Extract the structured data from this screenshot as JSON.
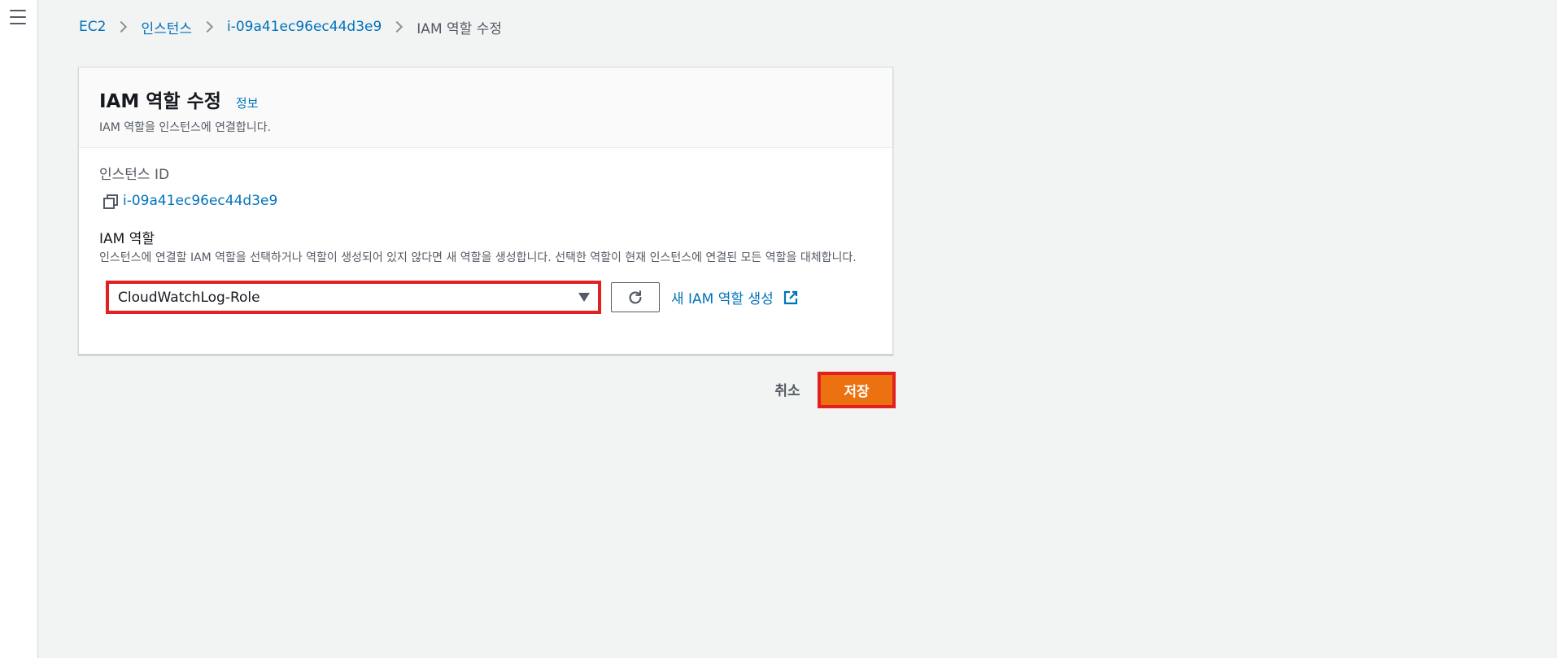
{
  "breadcrumb": {
    "items": [
      "EC2",
      "인스턴스",
      "i-09a41ec96ec44d3e9"
    ],
    "current": "IAM 역할 수정"
  },
  "panel": {
    "title": "IAM 역할 수정",
    "info": "정보",
    "description": "IAM 역할을 인스턴스에 연결합니다."
  },
  "instance": {
    "label": "인스턴스 ID",
    "id": "i-09a41ec96ec44d3e9"
  },
  "iam_role": {
    "label": "IAM 역할",
    "description": "인스턴스에 연결할 IAM 역할을 선택하거나 역할이 생성되어 있지 않다면 새 역할을 생성합니다. 선택한 역할이 현재 인스턴스에 연결된 모든 역할을 대체합니다.",
    "selected": "CloudWatchLog-Role",
    "create_link": "새 IAM 역할 생성"
  },
  "actions": {
    "cancel": "취소",
    "save": "저장"
  },
  "colors": {
    "link": "#0073bb",
    "primary": "#ec7211",
    "highlight": "#e22020"
  }
}
